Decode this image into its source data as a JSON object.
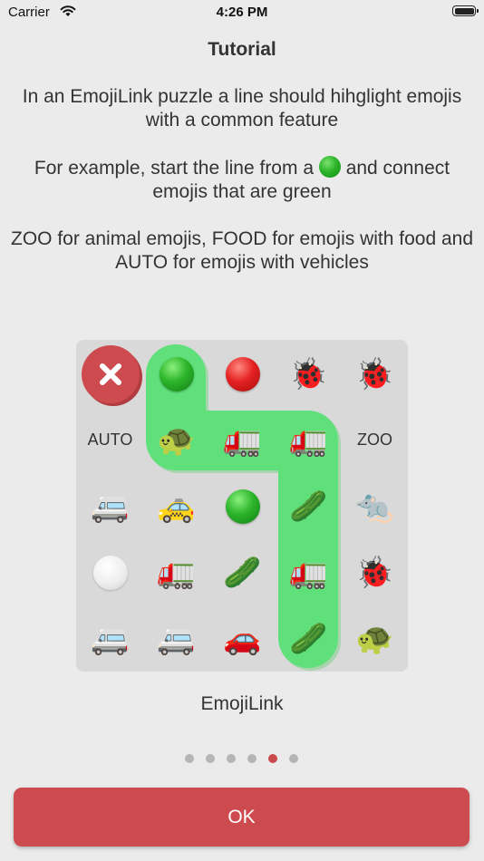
{
  "status_bar": {
    "carrier": "Carrier",
    "time": "4:26 PM",
    "battery_level": 1.0
  },
  "title": "Tutorial",
  "paragraphs": {
    "p1": "In an EmojiLink puzzle a line should hihglight emojis with a common feature",
    "p2_before": "For example, start the line from a",
    "p2_after": "and connect emojis that are green",
    "p3": "ZOO for animal emojis, FOOD for emojis with food and AUTO for emojis with vehicles"
  },
  "board": {
    "auto_label": "AUTO",
    "zoo_label": "ZOO",
    "line_color": "#5fe07a",
    "emojis": {
      "ladybug": "🐞",
      "turtle": "🐢",
      "truck": "🚛",
      "minibus": "🚐",
      "taxi": "🚕",
      "cucumber": "🥒",
      "rat": "🐀",
      "car": "🚗"
    }
  },
  "caption": "EmojiLink",
  "pager": {
    "count": 6,
    "current": 5
  },
  "ok_button": {
    "label": "OK"
  },
  "colors": {
    "accent": "#cd4b4f",
    "background": "#ebebeb",
    "board": "#d9d9d9"
  }
}
